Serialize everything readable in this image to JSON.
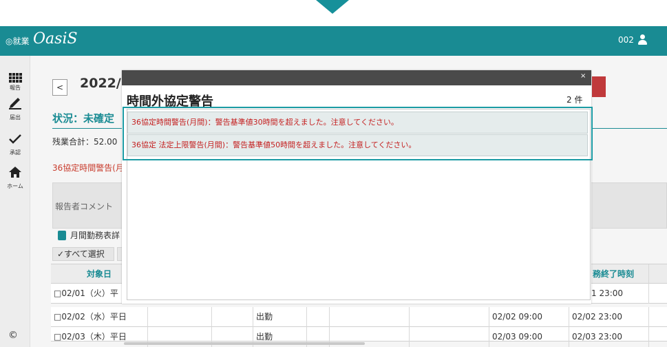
{
  "header": {
    "logo_small": "◎就業",
    "logo_big": "OasiS",
    "user_id": "002"
  },
  "sidebar": {
    "items": [
      {
        "label": "報告",
        "icon": "grid-icon"
      },
      {
        "label": "届出",
        "icon": "pencil-icon"
      },
      {
        "label": "承認",
        "icon": "check-icon"
      },
      {
        "label": "ホーム",
        "icon": "home-icon"
      }
    ],
    "footer_glyph": "©"
  },
  "main": {
    "prev_label": "<",
    "year_title": "2022/",
    "status": "状況：未確定",
    "overtime": "残業合計：52.00",
    "warning_text": "36協定時間警告(月",
    "comment_label": "報告者コメント",
    "monthly_link": "月間勤務表詳",
    "select_all": "✓すべて選択"
  },
  "table": {
    "headers": [
      "対象日",
      "",
      "",
      "",
      "",
      "",
      "",
      "",
      "務終了時刻",
      ""
    ],
    "rows": [
      [
        "□02/01（火）平",
        "",
        "",
        "",
        "",
        "",
        "",
        "",
        "1 23:00",
        ""
      ],
      [
        "□02/02（水）平日",
        "",
        "",
        "出勤",
        "",
        "",
        "",
        "02/02 09:00",
        "02/02 23:00",
        ""
      ],
      [
        "□02/03（木）平日",
        "",
        "",
        "出勤",
        "",
        "",
        "",
        "02/03 09:00",
        "02/03 23:00",
        ""
      ]
    ]
  },
  "modal": {
    "close_label": "×",
    "title": "時間外協定警告",
    "count": "2 件",
    "alerts": [
      "36協定時間警告(月間)：警告基準値30時間を超えました。注意してください。",
      "36協定 法定上限警告(月間)：警告基準値50時間を超えました。注意してください。"
    ]
  },
  "colors": {
    "brand_teal": "#198b93",
    "alert_red": "#c42020",
    "stamp_red": "#c0393b"
  }
}
